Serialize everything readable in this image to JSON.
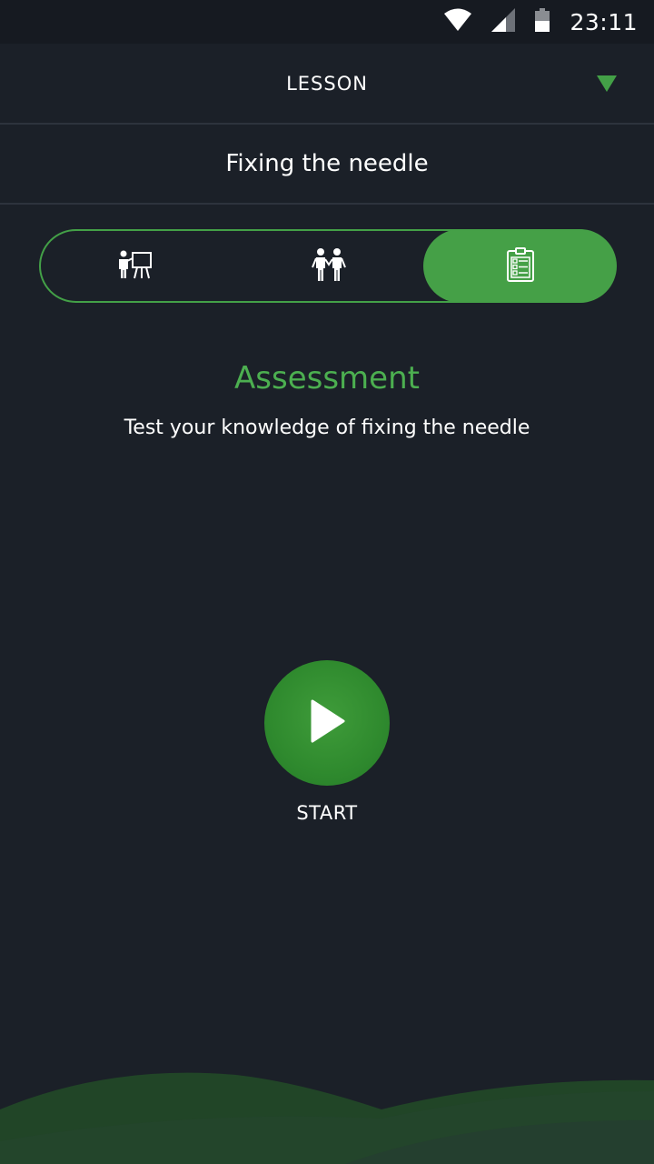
{
  "status_bar": {
    "time": "23:11",
    "icons": [
      "wifi-icon",
      "cellular-signal-icon",
      "battery-icon"
    ]
  },
  "header": {
    "title": "LESSON",
    "dropdown_icon": "triangle-down-icon"
  },
  "lesson": {
    "name": "Fixing the needle"
  },
  "tabs": [
    {
      "icon": "presenter-board-icon",
      "selected": false
    },
    {
      "icon": "two-people-icon",
      "selected": false
    },
    {
      "icon": "clipboard-checklist-icon",
      "selected": true
    }
  ],
  "section": {
    "title": "Assessment",
    "subtitle": "Test your knowledge of fixing the needle"
  },
  "start": {
    "label": "START",
    "icon": "play-icon"
  },
  "colors": {
    "background": "#1b2028",
    "accent": "#45a047",
    "accent_text": "#4caf50",
    "divider": "#2d333d"
  }
}
